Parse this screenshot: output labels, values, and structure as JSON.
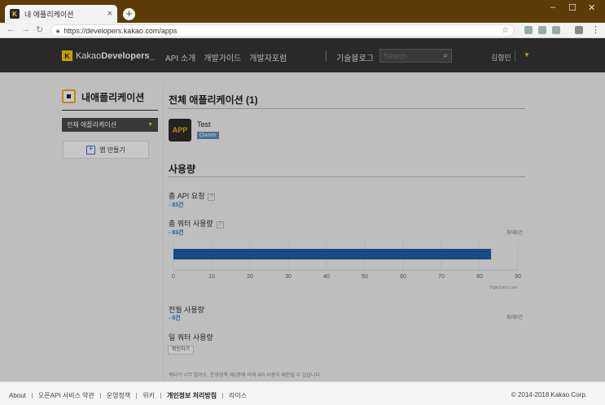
{
  "browser": {
    "tab_title": "내 애플리케이션",
    "tab_icon_letter": "K",
    "new_tab": "+",
    "url": "https://developers.kakao.com/apps"
  },
  "header": {
    "logo_kakao": "Kakao",
    "logo_dev": "Developers_",
    "nav": [
      "API 소개",
      "개발가이드",
      "개발자포럼"
    ],
    "blog": "기술블로그",
    "search_placeholder": "Search",
    "user": "김형민"
  },
  "sidebar": {
    "title": "내애플리케이션",
    "select_value": "전체 애플리케이션",
    "create_label": "앱 만들기"
  },
  "apps": {
    "heading": "전체 애플리케이션 (1)",
    "items": [
      {
        "icon_text": "APP",
        "name": "Test",
        "badge": "Owner"
      }
    ]
  },
  "usage": {
    "heading": "사용량",
    "total_api_label": "총 API 요청",
    "total_api_value": "- 83건",
    "total_quota_label": "총 쿼터 사용량",
    "total_quota_value": "- 83건",
    "max_label_1": "최대0건",
    "month_label": "전월 사용량",
    "month_value": "- 0건",
    "max_label_2": "최대0건",
    "daily_label": "일 쿼터 사용량",
    "check_button": "확인하기",
    "note": "쿼터가 너무 많아도, 운영정책 제1항에 의해 API 사용이 제한될 수 있습니다.",
    "credits": "Highcharts.com"
  },
  "chart_data": {
    "type": "bar",
    "categories": [
      ""
    ],
    "values": [
      83
    ],
    "xlim": [
      0,
      90
    ],
    "ticks": [
      "0",
      "10",
      "20",
      "30",
      "40",
      "50",
      "60",
      "70",
      "80",
      "90"
    ],
    "color": "#1f5fa8",
    "orientation": "horizontal"
  },
  "footer": {
    "links": [
      "About",
      "오픈API 서비스 약관",
      "운영정책",
      "위키",
      "개인정보 처리방침",
      "라이스"
    ],
    "copyright": "© 2014-2018 Kakao Corp."
  }
}
